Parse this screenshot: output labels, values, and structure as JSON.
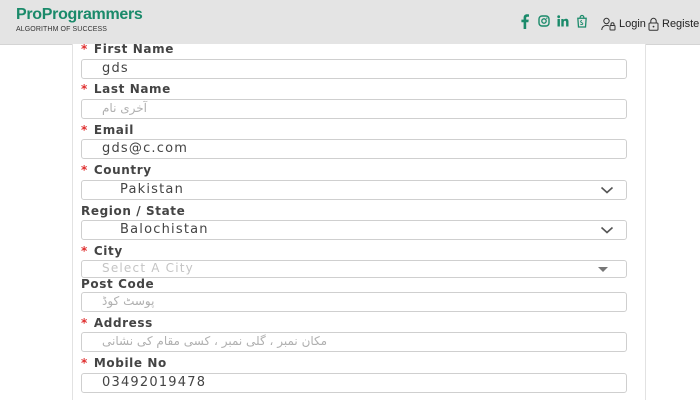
{
  "header": {
    "brand_name": "ProProgrammers",
    "tagline": "ALGORITHM OF SUCCESS",
    "login_label": "Login",
    "register_label": "Register",
    "brand_color": "#1a8a6a",
    "social_icons": [
      "facebook-icon",
      "instagram-icon",
      "linkedin-icon",
      "shopify-icon"
    ]
  },
  "form": {
    "first_name": {
      "label": "First Name",
      "required": true,
      "value": "gds"
    },
    "last_name": {
      "label": "Last Name",
      "required": true,
      "placeholder": "آخری نام"
    },
    "email": {
      "label": "Email",
      "required": true,
      "value": "gds@c.com"
    },
    "country": {
      "label": "Country",
      "required": true,
      "value": "Pakistan"
    },
    "region": {
      "label": "Region / State",
      "required": false,
      "value": "Balochistan"
    },
    "city": {
      "label": "City",
      "required": true,
      "placeholder": "Select A City"
    },
    "post_code": {
      "label": "Post Code",
      "required": false,
      "placeholder": "پوسٹ کوڈ"
    },
    "address": {
      "label": "Address",
      "required": true,
      "placeholder": "مکان نمبر ، گلی نمبر ، کسی مقام کی نشانی"
    },
    "mobile": {
      "label": "Mobile No",
      "required": true,
      "value": "03492019478"
    }
  },
  "required_color": "#e03030"
}
